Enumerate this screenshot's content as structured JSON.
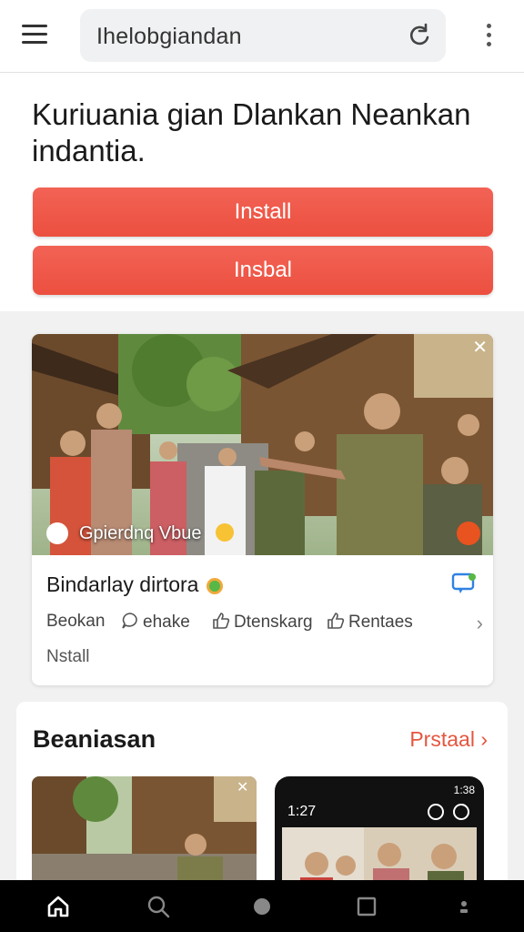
{
  "browser": {
    "address": "Ihelobgiandan",
    "icons": [
      "menu-icon",
      "reload-icon",
      "more-vertical-icon"
    ]
  },
  "hero": {
    "title": "Kuriuania gian Dlankan Neankan indantia.",
    "buttons": [
      "Install",
      "Insbal"
    ]
  },
  "card": {
    "caption": "Gpierdnq Vbue",
    "title": "Bindarlay dirtora",
    "actions": [
      "Beokan",
      "ehake",
      "Dtenskarg",
      "Rentaes"
    ],
    "footer": "Nstall"
  },
  "section": {
    "title": "Beaniasan",
    "link": "Prstaal",
    "phone_time": "1:27",
    "phone_status": "1:38"
  },
  "colors": {
    "accent": "#ec4f3f",
    "link": "#e5553f",
    "background": "#f1f1f1"
  },
  "nav": [
    "home-icon",
    "search-icon",
    "circle-icon",
    "square-icon",
    "profile-icon"
  ]
}
